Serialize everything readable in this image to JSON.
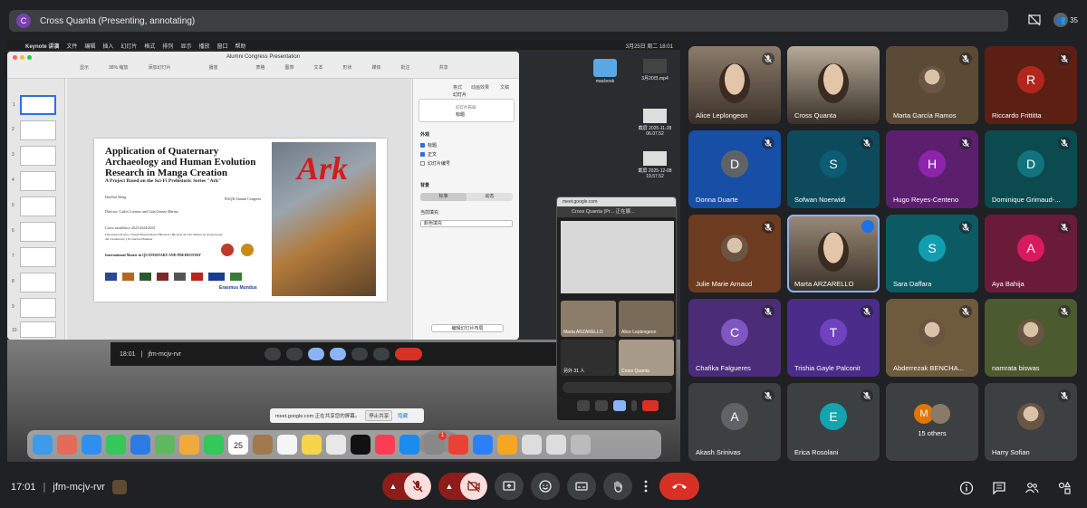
{
  "presenter": {
    "avatar_letter": "C",
    "title": "Cross Quanta (Presenting, annotating)",
    "people_count": "35"
  },
  "shared_screen": {
    "menubar": {
      "app": "Keynote 讲演",
      "items": [
        "文件",
        "编辑",
        "插入",
        "幻灯片",
        "格式",
        "排列",
        "显示",
        "播放",
        "窗口",
        "帮助"
      ],
      "clock": "3月25日 周二 18:01"
    },
    "keynote": {
      "doc_title": "Alumni Congress Presentation",
      "zoom": "38%",
      "toolbar_items": [
        "显示",
        "缩放",
        "添加幻灯片",
        "播放",
        "表格",
        "图表",
        "文本",
        "形状",
        "媒体",
        "批注",
        "共享"
      ],
      "inspector_tabs": [
        "格式",
        "动画效果",
        "文稿"
      ],
      "inspector_heading": "幻灯片",
      "layout_label": "幻灯片布局",
      "layout_value": "标题",
      "appearance_label": "外观",
      "checks": [
        {
          "label": "标题",
          "on": true
        },
        {
          "label": "正文",
          "on": true
        },
        {
          "label": "幻灯片编号",
          "on": false
        }
      ],
      "background_label": "背景",
      "seg": [
        "标准",
        "动态"
      ],
      "fill_label": "当前填充",
      "fill_value": "颜色填充",
      "edit_layout": "编辑幻灯片布局",
      "thumb_numbers": [
        "1",
        "2",
        "3",
        "4",
        "5",
        "6",
        "7",
        "8",
        "9",
        "10"
      ],
      "slide": {
        "title": "Application of Quaternary Archaeology and Human Evolution Research in Manga Creation",
        "subtitle": "A Project Based on the Sci-Fi Prehistoric Series \"Ark\"",
        "author": "HuaYan Weng",
        "event": "BAQR Alumni Congress",
        "director": "Director: Carlos Lorenzo and Gala Gómez Merino",
        "course": "Curso académico 2023/2024/2025",
        "university": "Universitat Rovira i Virgili Departament d'Història i Història de l'Art Máster en Arqueología del Cuaternario y Evolución Humana",
        "master": "International Master in QUATERNARY AND PREHISTORY",
        "erasmus": "Erasmus Mundus",
        "poster_text": "Ark"
      }
    },
    "desktop_items": [
      {
        "label": "macbook"
      },
      {
        "label": "3月20日.mp4"
      },
      {
        "label": "截屏 2025-11-28 06.07.52"
      },
      {
        "label": "截屏 2025-12-08 19.57.52"
      }
    ],
    "pip": {
      "url": "meet.google.com",
      "title": "Cross Quanta (Pr... 正在展...",
      "tiles": [
        "Marta ARZARELLO",
        "Alice Leplongeon",
        "另外 31 人",
        "Cross Quanta"
      ]
    },
    "inner_bar": {
      "time": "18:01",
      "code": "jfm-mcjv-rvr"
    },
    "share_note": {
      "text": "meet.google.com 正在共享您的屏幕。",
      "stop": "停止共享",
      "hide": "隐藏"
    },
    "dock_date": "25",
    "dock_badge": "1"
  },
  "participants": [
    {
      "name": "Alice Leplongeon",
      "type": "video",
      "color": "#8b7b6a",
      "muted": true
    },
    {
      "name": "Cross Quanta",
      "type": "video",
      "color": "#b5aa98",
      "muted": false
    },
    {
      "name": "Marta García Ramos",
      "type": "photo",
      "color": "#5b4a35",
      "muted": true
    },
    {
      "name": "Riccardo Frittitta",
      "type": "letter",
      "letter": "R",
      "color": "#b3261e",
      "bg": "#5c1f14",
      "muted": true
    },
    {
      "name": "Donna Duarte",
      "type": "letter",
      "letter": "D",
      "color": "#5f6368",
      "bg": "#174ea6",
      "muted": true
    },
    {
      "name": "Sofwan Noerwidi",
      "type": "letter",
      "letter": "S",
      "color": "#0b5d74",
      "bg": "#0d4b5c",
      "muted": true
    },
    {
      "name": "Hugo Reyes-Centeno",
      "type": "letter",
      "letter": "H",
      "color": "#8e24aa",
      "bg": "#5b1f6e",
      "muted": true
    },
    {
      "name": "Dominique Grimaud-...",
      "type": "letter",
      "letter": "D",
      "color": "#12737d",
      "bg": "#0b4a4f",
      "muted": true
    },
    {
      "name": "Julie Marie Arnaud",
      "type": "photo",
      "color": "#6d3b1f",
      "muted": true
    },
    {
      "name": "Marta ARZARELLO",
      "type": "video",
      "color": "#9a8a78",
      "muted": false,
      "speaking": true
    },
    {
      "name": "Sara Daffara",
      "type": "letter",
      "letter": "S",
      "color": "#129eaf",
      "bg": "#0c5a64",
      "muted": true
    },
    {
      "name": "Aya Bahija",
      "type": "letter",
      "letter": "A",
      "color": "#d81b60",
      "bg": "#6b1b3a",
      "muted": true
    },
    {
      "name": "Chafika Falgueres",
      "type": "letter",
      "letter": "C",
      "color": "#7e57c2",
      "bg": "#4a2c78",
      "muted": true
    },
    {
      "name": "Trishia Gayle Palconit",
      "type": "letter",
      "letter": "T",
      "color": "#6f42c1",
      "bg": "#4a2c8a",
      "muted": true
    },
    {
      "name": "Abderrezak BENCHA...",
      "type": "photo",
      "color": "#6e5a3c",
      "muted": true
    },
    {
      "name": "namrata biswas",
      "type": "photo",
      "color": "#4c5a2f",
      "muted": true
    },
    {
      "name": "Akash Srinivas",
      "type": "letter",
      "letter": "A",
      "color": "#5f6368",
      "bg": "#3c4043",
      "muted": true
    },
    {
      "name": "Erica Rosolani",
      "type": "letter",
      "letter": "E",
      "color": "#12a4af",
      "bg": "#3c4043",
      "muted": true
    },
    {
      "name": "15 others",
      "type": "others",
      "color": "#3c4043",
      "muted": false
    },
    {
      "name": "Harry Sofian",
      "type": "photo",
      "color": "#3c4043",
      "muted": true
    }
  ],
  "bottom_bar": {
    "time": "17:01",
    "separator": "|",
    "meeting_code": "jfm-mcjv-rvr"
  },
  "colors": {
    "end_call": "#d93025",
    "mic_off_bg": "#8c1d18",
    "accent": "#8ab4f8"
  }
}
